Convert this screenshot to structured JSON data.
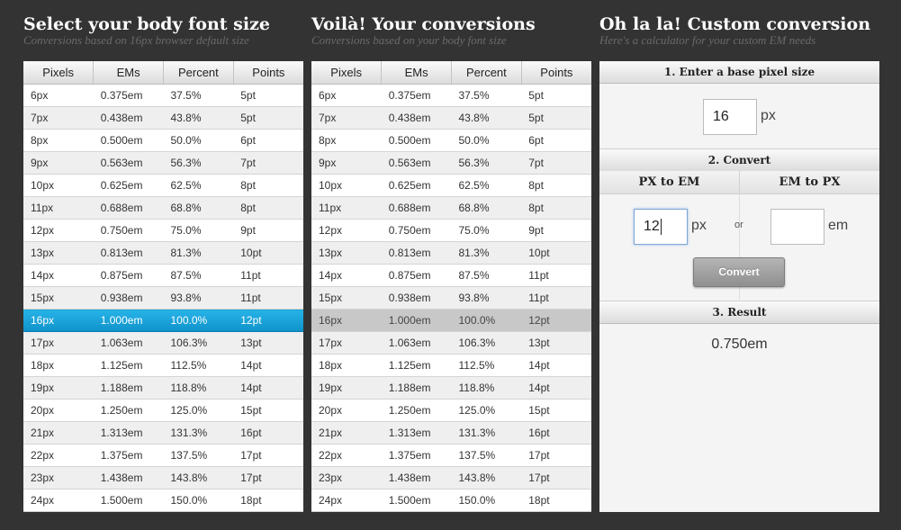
{
  "col1": {
    "title": "Select your body font size",
    "subtitle": "Conversions based on 16px browser default size"
  },
  "col2": {
    "title": "Voilà! Your conversions",
    "subtitle": "Conversions based on your body font size"
  },
  "col3": {
    "title": "Oh la la! Custom conversion",
    "subtitle": "Here's a calculator for your custom EM needs"
  },
  "headers": [
    "Pixels",
    "EMs",
    "Percent",
    "Points"
  ],
  "rows": [
    [
      "6px",
      "0.375em",
      "37.5%",
      "5pt"
    ],
    [
      "7px",
      "0.438em",
      "43.8%",
      "5pt"
    ],
    [
      "8px",
      "0.500em",
      "50.0%",
      "6pt"
    ],
    [
      "9px",
      "0.563em",
      "56.3%",
      "7pt"
    ],
    [
      "10px",
      "0.625em",
      "62.5%",
      "8pt"
    ],
    [
      "11px",
      "0.688em",
      "68.8%",
      "8pt"
    ],
    [
      "12px",
      "0.750em",
      "75.0%",
      "9pt"
    ],
    [
      "13px",
      "0.813em",
      "81.3%",
      "10pt"
    ],
    [
      "14px",
      "0.875em",
      "87.5%",
      "11pt"
    ],
    [
      "15px",
      "0.938em",
      "93.8%",
      "11pt"
    ],
    [
      "16px",
      "1.000em",
      "100.0%",
      "12pt"
    ],
    [
      "17px",
      "1.063em",
      "106.3%",
      "13pt"
    ],
    [
      "18px",
      "1.125em",
      "112.5%",
      "14pt"
    ],
    [
      "19px",
      "1.188em",
      "118.8%",
      "14pt"
    ],
    [
      "20px",
      "1.250em",
      "125.0%",
      "15pt"
    ],
    [
      "21px",
      "1.313em",
      "131.3%",
      "16pt"
    ],
    [
      "22px",
      "1.375em",
      "137.5%",
      "17pt"
    ],
    [
      "23px",
      "1.438em",
      "143.8%",
      "17pt"
    ],
    [
      "24px",
      "1.500em",
      "150.0%",
      "18pt"
    ]
  ],
  "selected_row": 10,
  "colors": {
    "selected": "#1aa3d9",
    "match": "#c8c8c8",
    "background": "#333333"
  },
  "calc": {
    "step1": "1. Enter a base pixel size",
    "base_value": "16",
    "base_unit": "px",
    "step2": "2. Convert",
    "px_to_em": "PX to EM",
    "em_to_px": "EM to PX",
    "px_value": "12",
    "px_unit": "px",
    "or": "or",
    "em_value": "",
    "em_unit": "em",
    "convert_label": "Convert",
    "step3": "3. Result",
    "result": "0.750em"
  }
}
